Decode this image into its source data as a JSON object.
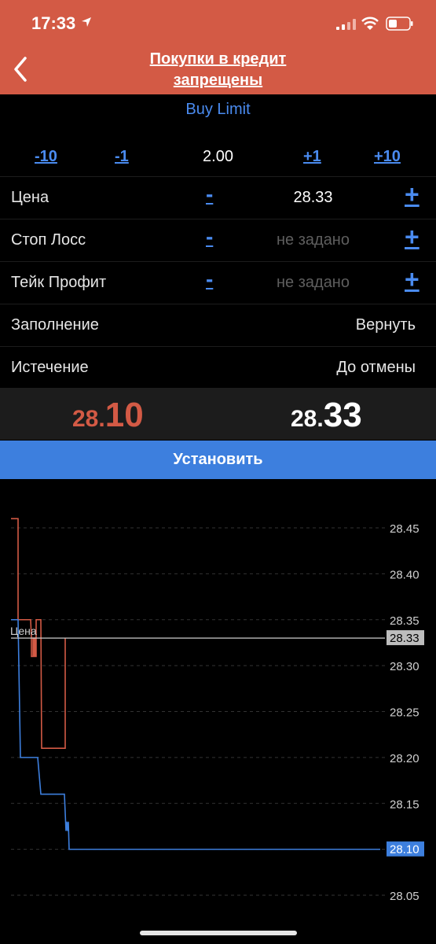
{
  "status_bar": {
    "time": "17:33"
  },
  "header": {
    "title_line1": "Покупки в кредит",
    "title_line2": "запрещены"
  },
  "order": {
    "type": "Buy Limit"
  },
  "volume": {
    "minus10": "-10",
    "minus1": "-1",
    "value": "2.00",
    "plus1": "+1",
    "plus10": "+10"
  },
  "form": {
    "price_label": "Цена",
    "price_value": "28.33",
    "stop_loss_label": "Стоп Лосс",
    "stop_loss_value": "не задано",
    "take_profit_label": "Тейк Профит",
    "take_profit_value": "не задано",
    "minus_symbol": "-",
    "plus_symbol": "+",
    "filling_label": "Заполнение",
    "filling_value": "Вернуть",
    "expiration_label": "Истечение",
    "expiration_value": "До отмены"
  },
  "quotes": {
    "bid_prefix": "28.",
    "bid_suffix": "10",
    "ask_prefix": "28.",
    "ask_suffix": "33"
  },
  "submit_label": "Установить",
  "colors": {
    "header_bg": "#d35a45",
    "accent_blue": "#4a8bf0",
    "button_blue": "#3d7fde",
    "bid_red": "#d35a45"
  },
  "chart_data": {
    "type": "line",
    "yticks": [
      "28.45",
      "28.40",
      "28.35",
      "28.30",
      "28.25",
      "28.20",
      "28.15",
      "28.10",
      "28.05"
    ],
    "ylim": [
      28.045,
      28.47
    ],
    "price_line": {
      "label": "Цена",
      "value": 28.33,
      "tag": "28.33"
    },
    "bid_tag": {
      "value": 28.1,
      "tag": "28.10"
    },
    "series": [
      {
        "color": "#d35a45",
        "x": [
          0,
          9,
          9,
          21,
          25,
          26,
          26,
          28,
          28,
          29,
          29,
          30,
          30,
          31,
          31,
          32,
          32,
          38,
          39,
          68,
          69,
          69
        ],
        "y": [
          28.46,
          28.46,
          28.35,
          28.35,
          28.35,
          28.33,
          28.31,
          28.31,
          28.33,
          28.33,
          28.31,
          28.31,
          28.33,
          28.33,
          28.31,
          28.31,
          28.35,
          28.35,
          28.21,
          28.21,
          28.21,
          28.33
        ]
      },
      {
        "color": "#3d7fde",
        "x": [
          0,
          9,
          12,
          34,
          38,
          41,
          68,
          70,
          71,
          72,
          73,
          74,
          470
        ],
        "y": [
          28.35,
          28.35,
          28.2,
          28.2,
          28.16,
          28.16,
          28.16,
          28.12,
          28.13,
          28.12,
          28.13,
          28.1,
          28.1
        ]
      }
    ]
  }
}
